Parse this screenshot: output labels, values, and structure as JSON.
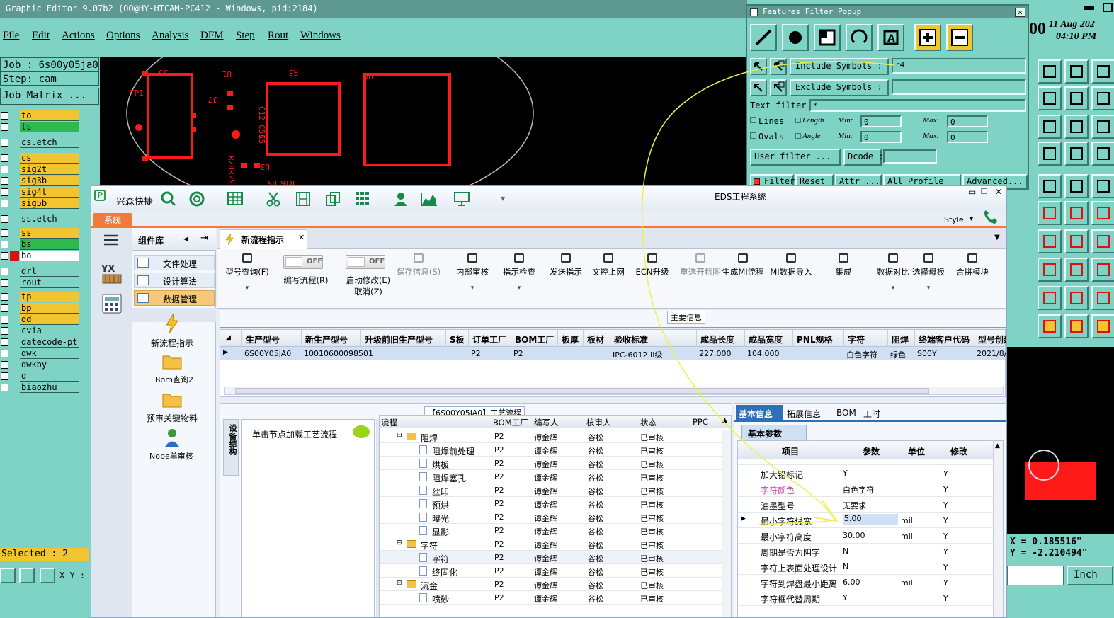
{
  "graphic_editor": {
    "title": "Graphic Editor 9.07b2 (OO@HY-HTCAM-PC412 - Windows, pid:2184)",
    "menu": [
      "File",
      "Edit",
      "Actions",
      "Options",
      "Analysis",
      "DFM",
      "Step",
      "Rout",
      "Windows"
    ],
    "job": "Job : 6s00y05ja0",
    "step": "Step: cam",
    "job_matrix": "Job Matrix ...",
    "layers": [
      "to",
      "ts",
      "cs.etch",
      "cs",
      "sig2t",
      "sig3b",
      "sig4t",
      "sig5b",
      "ss.etch",
      "ss",
      "bs",
      "bo",
      "drl",
      "rout",
      "tp",
      "bp",
      "dd",
      "cvia",
      "datecode-pt",
      "dwk",
      "dwkby",
      "d",
      "biaozhu"
    ],
    "selected": "Selected : 2",
    "xy_label": "X Y :",
    "canvas_labels": [
      "J5",
      "U1",
      "R3",
      "U6",
      "TP1",
      "J7",
      "C12",
      "C5",
      "C5S",
      "R28",
      "R29",
      "U3",
      "U5",
      "R16"
    ],
    "date": "11 Aug 202",
    "time": "04:10 PM",
    "clock_digits": "00",
    "coord_x": "X = 0.185516\"",
    "coord_y": "Y = -2.210494\"",
    "unit": "Inch"
  },
  "features_filter": {
    "title": "Features Filter Popup",
    "include_label": "Include Symbols :",
    "include_value": "r4",
    "exclude_label": "Exclude Symbols :",
    "text_filter_label": "Text filter",
    "text_filter_value": "*",
    "lines": "Lines",
    "ovals": "Ovals",
    "length": "Length",
    "angle": "Angle",
    "min": "Min:",
    "max": "Max:",
    "zero": "0",
    "user_filter": "User filter ...",
    "dcode": "Dcode :",
    "filter": "Filter",
    "reset": "Reset",
    "attr": "Attr ...",
    "all_profile": "All Profile",
    "advanced": "Advanced..."
  },
  "eds": {
    "title": "EDS工程系统",
    "brand": "兴森快捷",
    "style": "Style",
    "sys_tab": "系统",
    "component_lib": "组件库",
    "nav_items": [
      "文件处理",
      "设计算法",
      "数据管理"
    ],
    "side_icons": [
      "新流程指示",
      "Bom查询2",
      "预审关键物料",
      "Nope单审核"
    ],
    "doc_tab": "新流程指示",
    "toolbar": [
      {
        "label": "型号查询(F)"
      },
      {
        "label": "编写流程(R)",
        "toggle": "OFF"
      },
      {
        "label": "启动修改(E)",
        "label2": "取消(Z)",
        "toggle": "OFF"
      },
      {
        "label": "保存信息(S)"
      },
      {
        "label": "内部审核"
      },
      {
        "label": "指示检查"
      },
      {
        "label": "发送指示"
      },
      {
        "label": "文控上网"
      },
      {
        "label": "ECN升级"
      },
      {
        "label": "重选开料图"
      },
      {
        "label": "生成MI流程"
      },
      {
        "label": "MI数据导入"
      },
      {
        "label": "集成"
      },
      {
        "label": "数据对比"
      },
      {
        "label": "选择母板"
      },
      {
        "label": "合拼模块"
      },
      {
        "label": "导"
      }
    ],
    "main_info": "主要信息",
    "top_grid": {
      "headers": [
        "生产型号",
        "新生产型号",
        "升级前旧生产型号",
        "S板",
        "订单工厂",
        "BOM工厂",
        "板厚",
        "板材",
        "验收标准",
        "成品长度",
        "成品宽度",
        "PNL规格",
        "字符",
        "阻焊",
        "终端客户代码",
        "型号创建"
      ],
      "row": [
        "6S00Y05JA0",
        "10010600098501",
        "",
        "",
        "P2",
        "P2",
        "",
        "",
        "IPC-6012 II级",
        "227.000",
        "104.000",
        "",
        "白色字符",
        "绿色",
        "S00Y",
        "2021/8/6"
      ]
    },
    "process_title": "【6S00Y05JA0】工艺流程",
    "vertical_tab": "设备结构",
    "load_hint": "单击节点加载工艺流程",
    "process_headers": [
      "流程",
      "BOM工厂",
      "编写人",
      "核审人",
      "状态",
      "PPC"
    ],
    "process_rows": [
      {
        "name": "阻焊",
        "folder": true,
        "bom": "P2",
        "writer": "谭金辉",
        "reviewer": "谷松",
        "status": "已审核"
      },
      {
        "name": "阻焊前处理",
        "bom": "P2",
        "writer": "谭金辉",
        "reviewer": "谷松",
        "status": "已审核"
      },
      {
        "name": "烘板",
        "bom": "P2",
        "writer": "谭金辉",
        "reviewer": "谷松",
        "status": "已审核"
      },
      {
        "name": "阻焊塞孔",
        "bom": "P2",
        "writer": "谭金辉",
        "reviewer": "谷松",
        "status": "已审核"
      },
      {
        "name": "丝印",
        "bom": "P2",
        "writer": "谭金辉",
        "reviewer": "谷松",
        "status": "已审核"
      },
      {
        "name": "预烘",
        "bom": "P2",
        "writer": "谭金辉",
        "reviewer": "谷松",
        "status": "已审核"
      },
      {
        "name": "曝光",
        "bom": "P2",
        "writer": "谭金辉",
        "reviewer": "谷松",
        "status": "已审核"
      },
      {
        "name": "显影",
        "bom": "P2",
        "writer": "谭金辉",
        "reviewer": "谷松",
        "status": "已审核"
      },
      {
        "name": "字符",
        "folder": true,
        "bom": "P2",
        "writer": "谭金辉",
        "reviewer": "谷松",
        "status": "已审核"
      },
      {
        "name": "字符",
        "bom": "P2",
        "writer": "谭金辉",
        "reviewer": "谷松",
        "status": "已审核"
      },
      {
        "name": "终固化",
        "bom": "P2",
        "writer": "谭金辉",
        "reviewer": "谷松",
        "status": "已审核"
      },
      {
        "name": "沉金",
        "folder": true,
        "bom": "P2",
        "writer": "谭金辉",
        "reviewer": "谷松",
        "status": "已审核"
      },
      {
        "name": "喷砂",
        "bom": "P2",
        "writer": "谭金辉",
        "reviewer": "谷松",
        "status": "已审核"
      }
    ],
    "info_tabs": [
      "基本信息",
      "拓展信息",
      "BOM",
      "工时"
    ],
    "basic_params": "基本参数",
    "param_headers": [
      "项目",
      "参数",
      "单位",
      "修改"
    ],
    "param_rows": [
      {
        "item": "加大铅标记",
        "value": "Y",
        "unit": "",
        "mod": "Y"
      },
      {
        "item": "字符颜色",
        "value": "白色字符",
        "unit": "",
        "mod": "Y",
        "pink": true
      },
      {
        "item": "油墨型号",
        "value": "无要求",
        "unit": "",
        "mod": "Y"
      },
      {
        "item": "最小字符线宽",
        "value": "5.00",
        "unit": "mil",
        "mod": "Y",
        "selected": true
      },
      {
        "item": "最小字符高度",
        "value": "30.00",
        "unit": "mil",
        "mod": "Y"
      },
      {
        "item": "周期是否为阴字",
        "value": "N",
        "unit": "",
        "mod": "Y"
      },
      {
        "item": "字符上表面处理设计",
        "value": "N",
        "unit": "",
        "mod": "Y"
      },
      {
        "item": "字符到焊盘最小距离",
        "value": "6.00",
        "unit": "mil",
        "mod": "Y"
      },
      {
        "item": "字符框代替周期",
        "value": "Y",
        "unit": "",
        "mod": "Y"
      }
    ]
  }
}
